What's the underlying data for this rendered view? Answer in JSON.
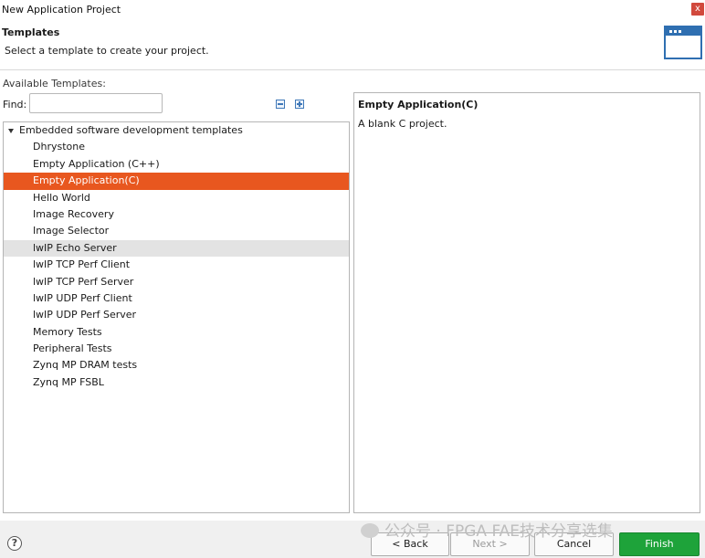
{
  "window": {
    "title": "New Application Project",
    "close_glyph": "x"
  },
  "header": {
    "title": "Templates",
    "description": "Select a template to create your project.",
    "icon": "wizard-window-icon"
  },
  "templates": {
    "available_label": "Available Templates:",
    "find_label": "Find:",
    "find_value": "",
    "collapse_icon": "collapse-all-icon",
    "expand_icon": "expand-all-icon",
    "tree": {
      "root_label": "Embedded software development templates",
      "items": [
        "Dhrystone",
        "Empty Application (C++)",
        "Empty Application(C)",
        "Hello World",
        "Image Recovery",
        "Image Selector",
        "lwIP Echo Server",
        "lwIP TCP Perf Client",
        "lwIP TCP Perf Server",
        "lwIP UDP Perf Client",
        "lwIP UDP Perf Server",
        "Memory Tests",
        "Peripheral Tests",
        "Zynq MP DRAM tests",
        "Zynq MP FSBL"
      ],
      "selected": "Empty Application(C)",
      "hovered": "lwIP Echo Server"
    }
  },
  "description": {
    "title": "Empty Application(C)",
    "text": "A blank C project."
  },
  "footer": {
    "help": "?",
    "back": "< Back",
    "next": "Next >",
    "cancel": "Cancel",
    "finish": "Finish"
  },
  "watermark": {
    "text": "公众号 · FPGA FAE技术分享选集"
  },
  "colors": {
    "selection": "#e8571f",
    "hover": "#e3e3e3",
    "finish_button": "#1ea33a",
    "icon_blue": "#2f6fb1"
  }
}
